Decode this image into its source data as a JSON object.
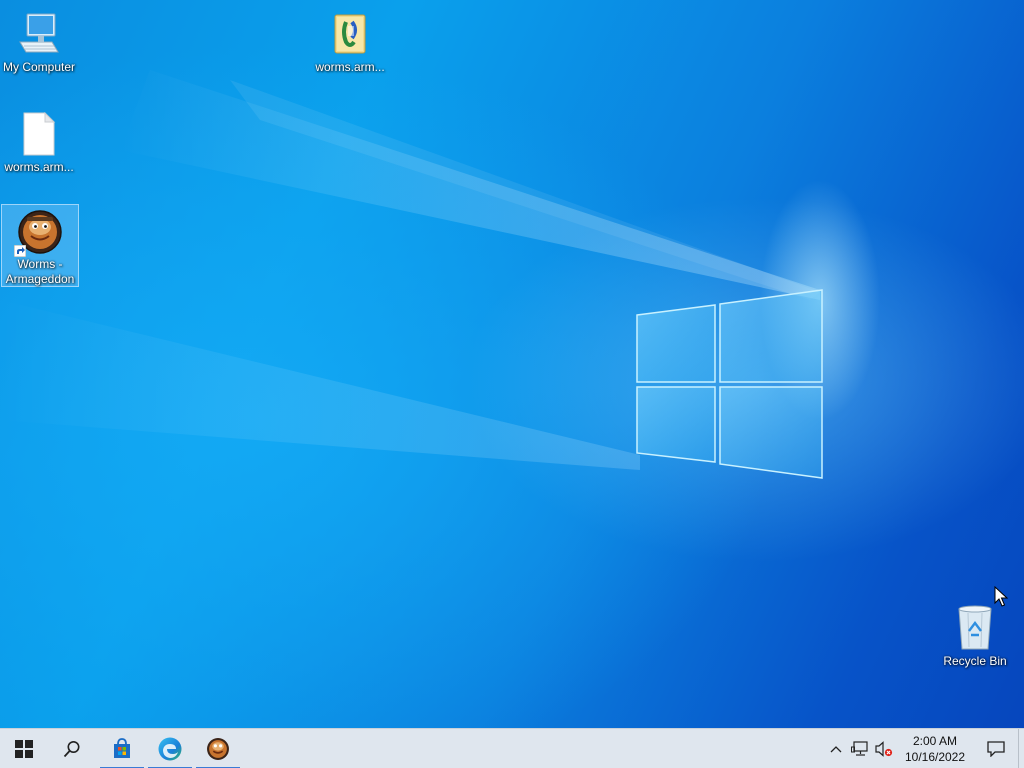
{
  "desktop": {
    "icons": [
      {
        "label": "My Computer",
        "icon": "computer-icon"
      },
      {
        "label": "worms.arm...",
        "icon": "blank-file-icon"
      },
      {
        "label": "Worms -\nArmageddon",
        "icon": "worms-game-icon",
        "shortcut": true,
        "selected": true
      },
      {
        "label": "worms.arm...",
        "icon": "installer-archive-icon"
      },
      {
        "label": "Recycle Bin",
        "icon": "recycle-bin-icon"
      }
    ]
  },
  "taskbar": {
    "start_icon": "windows-start-icon",
    "search_icon": "search-icon",
    "pinned": [
      {
        "name": "Microsoft Store",
        "icon": "store-icon"
      },
      {
        "name": "Microsoft Edge",
        "icon": "edge-icon"
      },
      {
        "name": "Worms Armageddon",
        "icon": "worms-game-icon"
      }
    ],
    "tray": {
      "show_hidden_icon": "chevron-up-icon",
      "network_icon": "network-icon",
      "volume_icon": "volume-muted-icon"
    },
    "clock": {
      "time": "2:00 AM",
      "date": "10/16/2022"
    },
    "notification_icon": "notification-icon"
  },
  "colors": {
    "accent": "#3a7bd5",
    "taskbar_bg": "#dfe6ee",
    "desktop_blue": "#0a8ee0"
  }
}
